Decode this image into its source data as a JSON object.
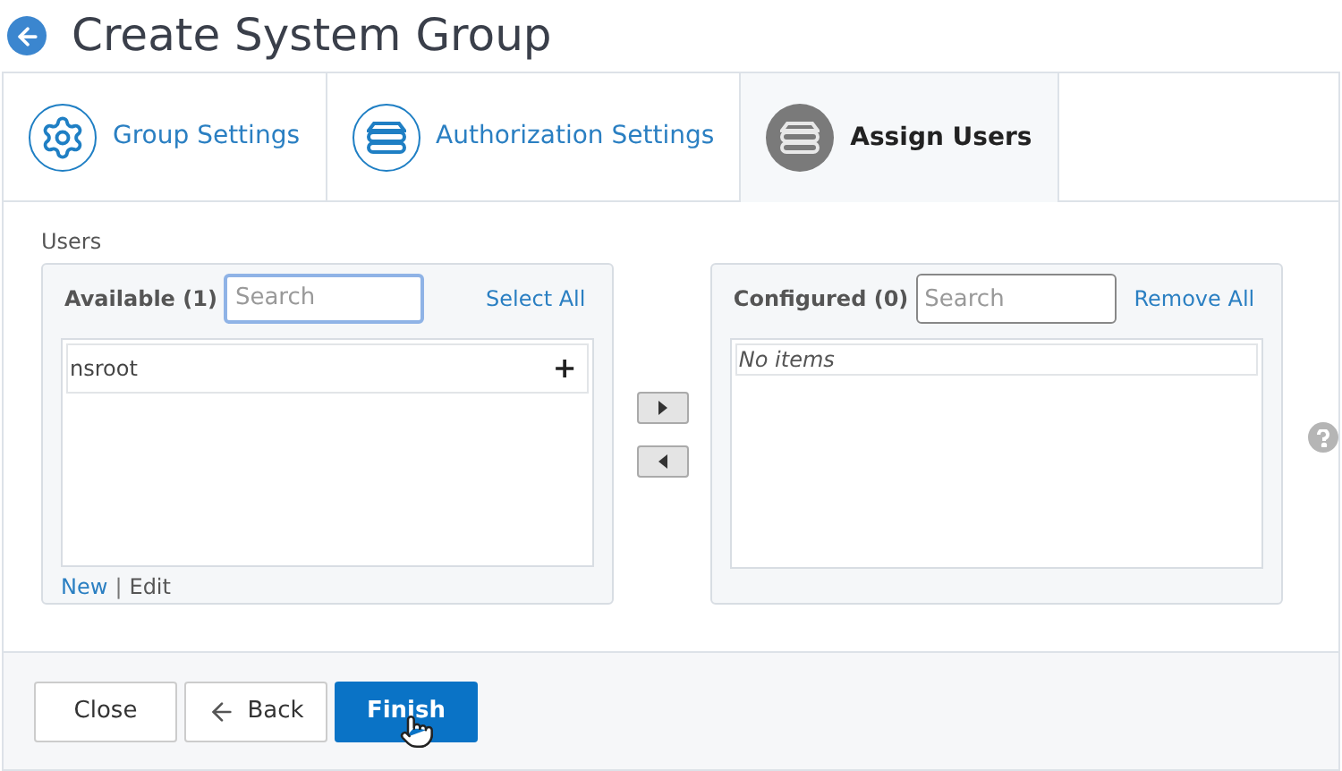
{
  "page": {
    "title": "Create System Group"
  },
  "tabs": [
    {
      "label": "Group Settings",
      "kind": "gear",
      "selected": false
    },
    {
      "label": "Authorization Settings",
      "kind": "server",
      "selected": false
    },
    {
      "label": "Assign Users",
      "kind": "server",
      "selected": true
    }
  ],
  "section_label": "Users",
  "available": {
    "heading": "Available (1)",
    "search": {
      "placeholder": "Search",
      "focused": true
    },
    "action": "Select All",
    "items": [
      {
        "name": "nsroot",
        "add": "+"
      }
    ],
    "links": [
      "New",
      "Edit"
    ],
    "separator": "|"
  },
  "configured": {
    "heading": "Configured (0)",
    "search": {
      "placeholder": "Search",
      "focused": false
    },
    "action": "Remove All",
    "empty_text": "No items"
  },
  "buttons": [
    {
      "label": "Close",
      "kind": "default"
    },
    {
      "label": "Back",
      "kind": "back"
    },
    {
      "label": "Finish",
      "kind": "primary"
    }
  ]
}
